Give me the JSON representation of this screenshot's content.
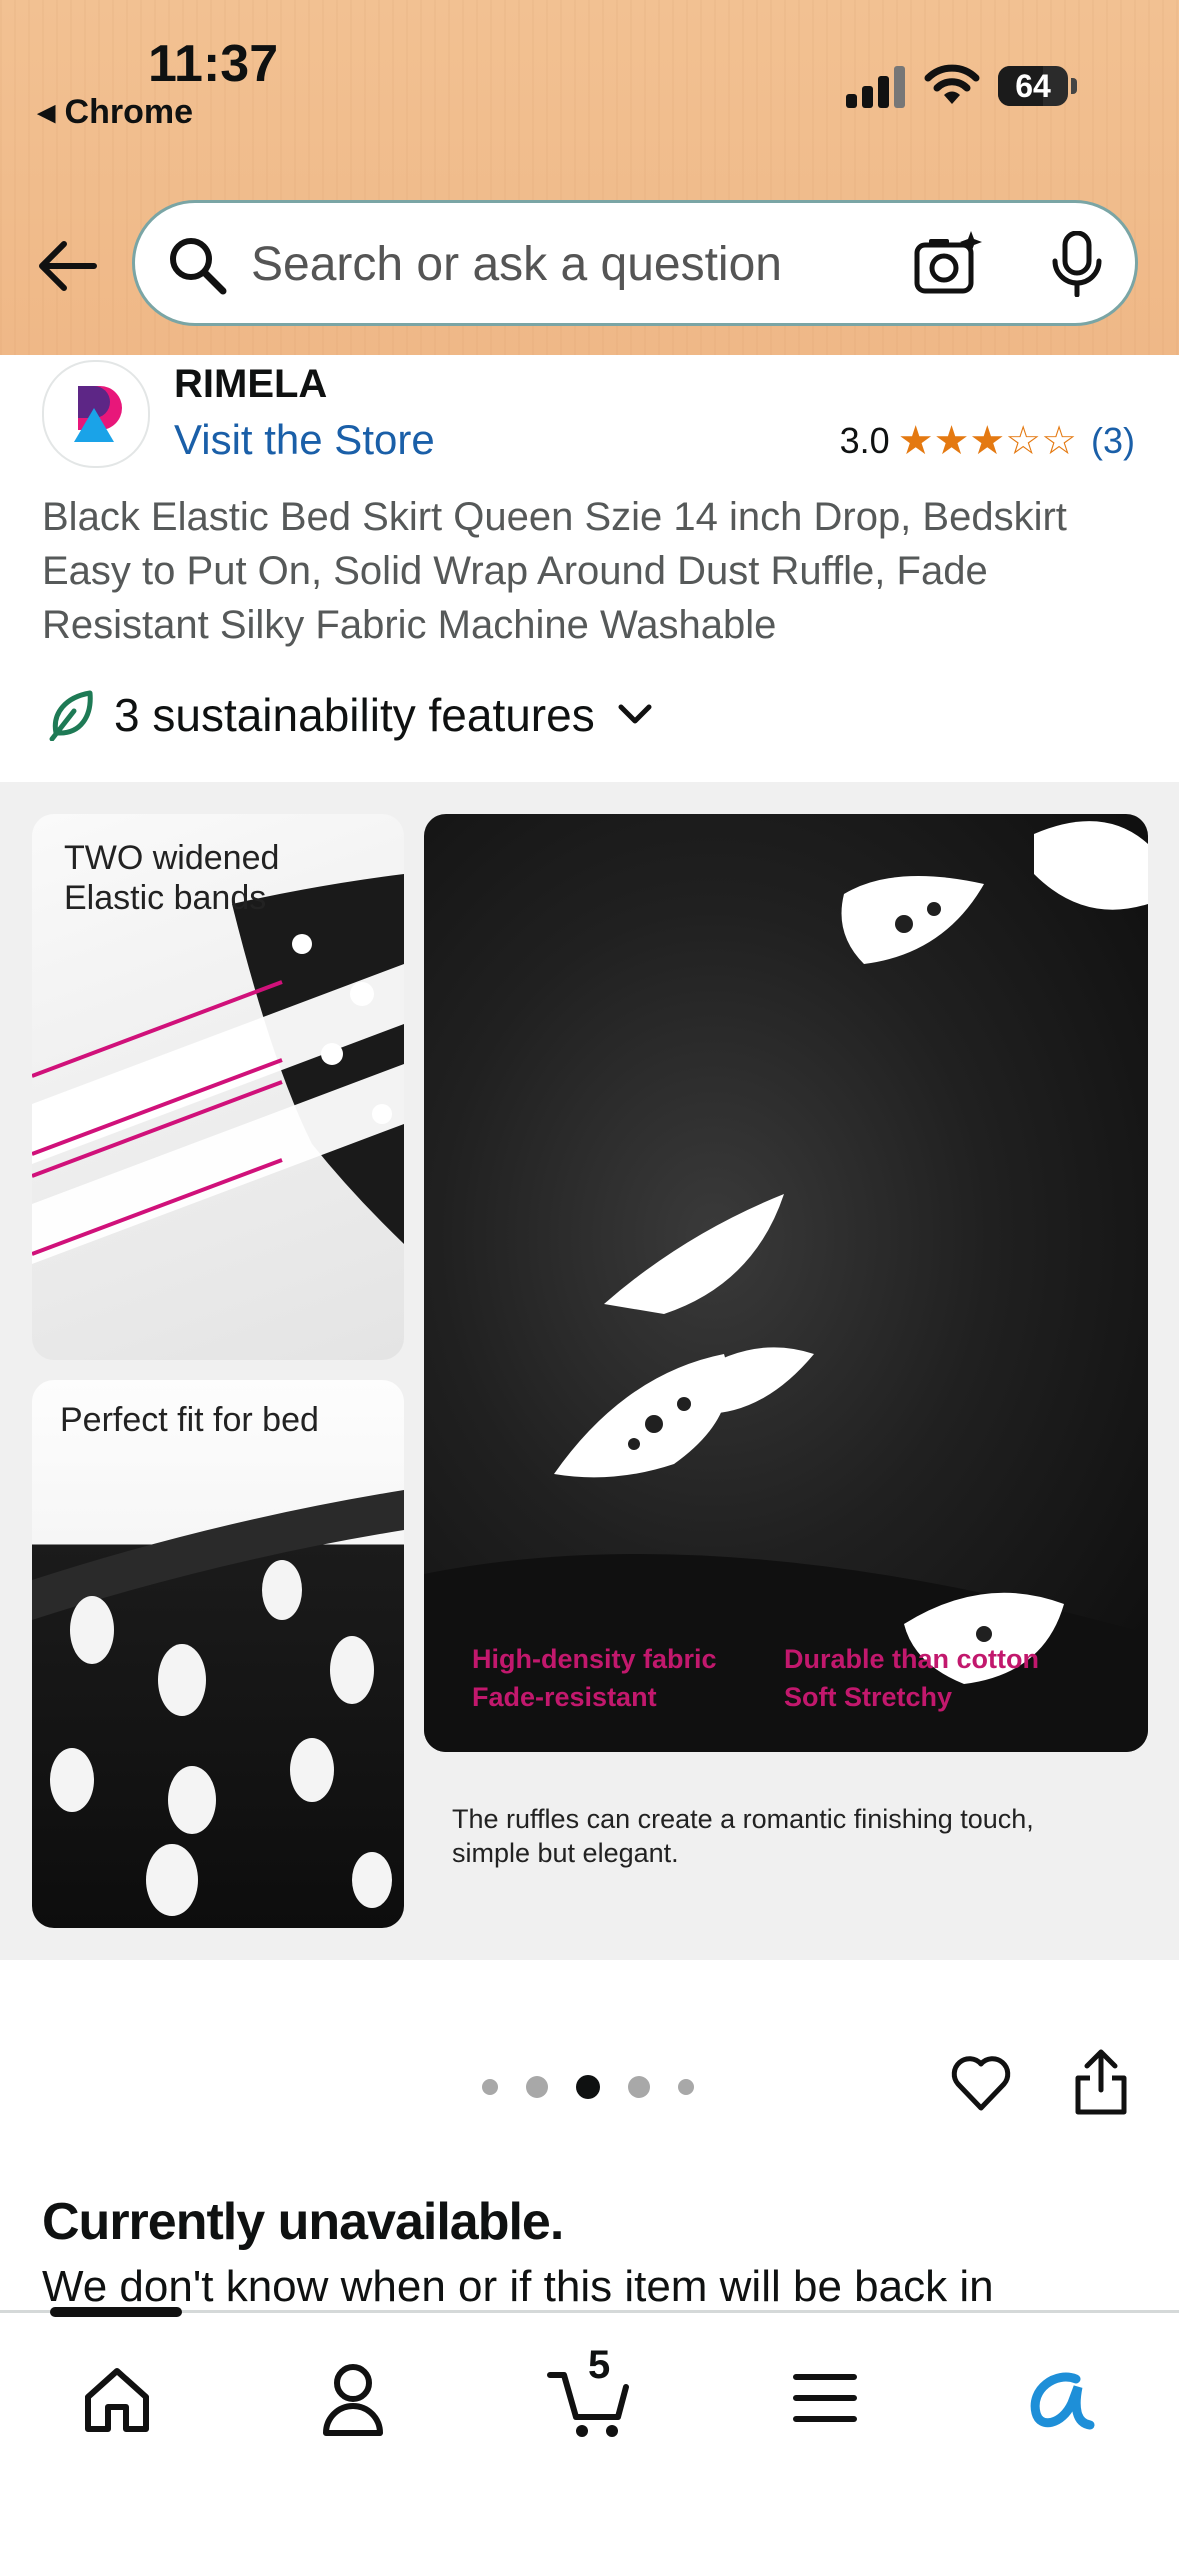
{
  "status_bar": {
    "time": "11:37",
    "back_app": "Chrome",
    "battery": "64"
  },
  "search": {
    "placeholder": "Search or ask a question"
  },
  "product": {
    "brand": "RIMELA",
    "store_link": "Visit the Store",
    "rating_value": "3.0",
    "rating_stars": 3,
    "review_count": "(3)",
    "title": "Black Elastic Bed Skirt Queen Szie 14 inch Drop, Bedskirt Easy to Put On, Solid Wrap Around Dust Ruffle, Fade Resistant Silky Fabric Machine Washable",
    "sustainability": "3 sustainability features"
  },
  "gallery": {
    "tile1_label_line1": "TWO widened",
    "tile1_label_line2": "Elastic bands",
    "tile2_label": "Perfect fit for bed",
    "feature_left_1": "High-density fabric",
    "feature_left_2": "Fade-resistant",
    "feature_right_1": "Durable than cotton",
    "feature_right_2": "Soft Stretchy",
    "caption_line1": "The ruffles can create a romantic finishing touch,",
    "caption_line2": "simple but elegant.",
    "image_count": 5,
    "active_index": 3
  },
  "availability": {
    "heading": "Currently unavailable.",
    "message": "We don't know when or if this item will be back in"
  },
  "bottom_nav": {
    "cart_count": "5"
  },
  "colors": {
    "header_bg": "#f0bc8c",
    "link": "#1a5fa8",
    "star": "#e47911",
    "accent_pink": "#c2186d",
    "rufus": "#1e8fd8"
  }
}
